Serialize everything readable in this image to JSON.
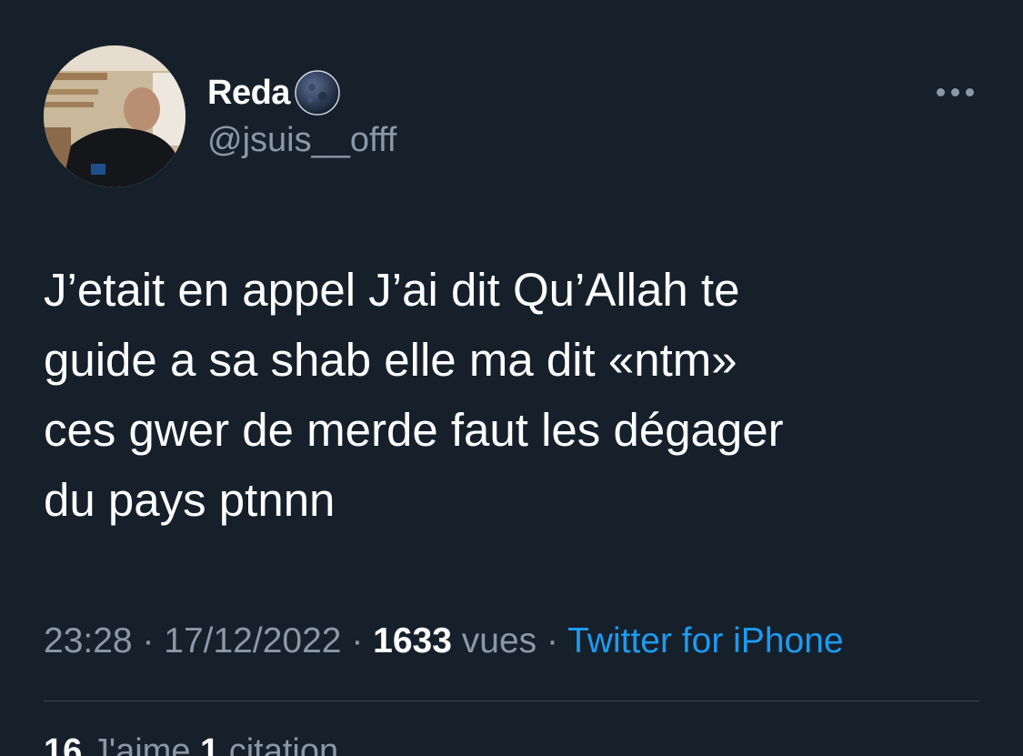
{
  "author": {
    "display_name": "Reda",
    "handle": "@jsuis__offf",
    "badge_icon": "moon-icon",
    "avatar_icon": "profile-photo"
  },
  "more_icon": "more-options-icon",
  "tweet": {
    "text": "J’etait en appel J’ai dit Qu’Allah te\nguide a sa shab elle ma dit «ntm»\nces gwer de merde faut les dégager\ndu pays ptnnn"
  },
  "meta": {
    "time": "23:28",
    "sep1": " · ",
    "date": "17/12/2022",
    "sep2": " · ",
    "views_count": "1633",
    "views_label": " vues",
    "sep3": " · ",
    "source": "Twitter for iPhone"
  },
  "stats": {
    "likes_count": "16",
    "likes_label": " J'aime",
    "quotes_count": "1",
    "quotes_label": " citation"
  },
  "colors": {
    "background": "#15202b",
    "text": "#ffffff",
    "secondary": "#8b98a5",
    "link": "#1d9bf0",
    "divider": "#38444d"
  }
}
